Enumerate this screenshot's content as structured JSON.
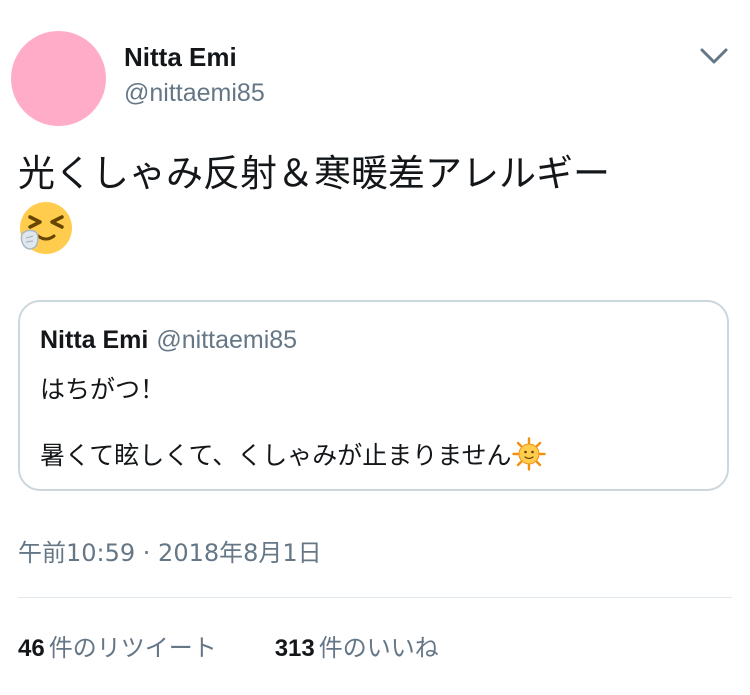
{
  "tweet": {
    "author_name": "Nitta Emi",
    "author_handle": "@nittaemi85",
    "avatar_color": "#ffacc8",
    "text": "光くしゃみ反射＆寒暖差アレルギー",
    "text_emoji": "sneezing-face-emoji",
    "timestamp": "午前10:59 · 2018年8月1日"
  },
  "quoted_tweet": {
    "author_name": "Nitta Emi",
    "author_handle": "@nittaemi85",
    "line1": "はちがつ！",
    "line2": "暑くて眩しくて、くしゃみが止まりません",
    "line2_emoji": "sun-with-face-emoji"
  },
  "stats": {
    "retweets_count": "46",
    "retweets_label": "件のリツイート",
    "likes_count": "313",
    "likes_label": "件のいいね"
  },
  "colors": {
    "primary_text": "#14171a",
    "secondary_text": "#657786",
    "border": "#ccd6dd"
  }
}
